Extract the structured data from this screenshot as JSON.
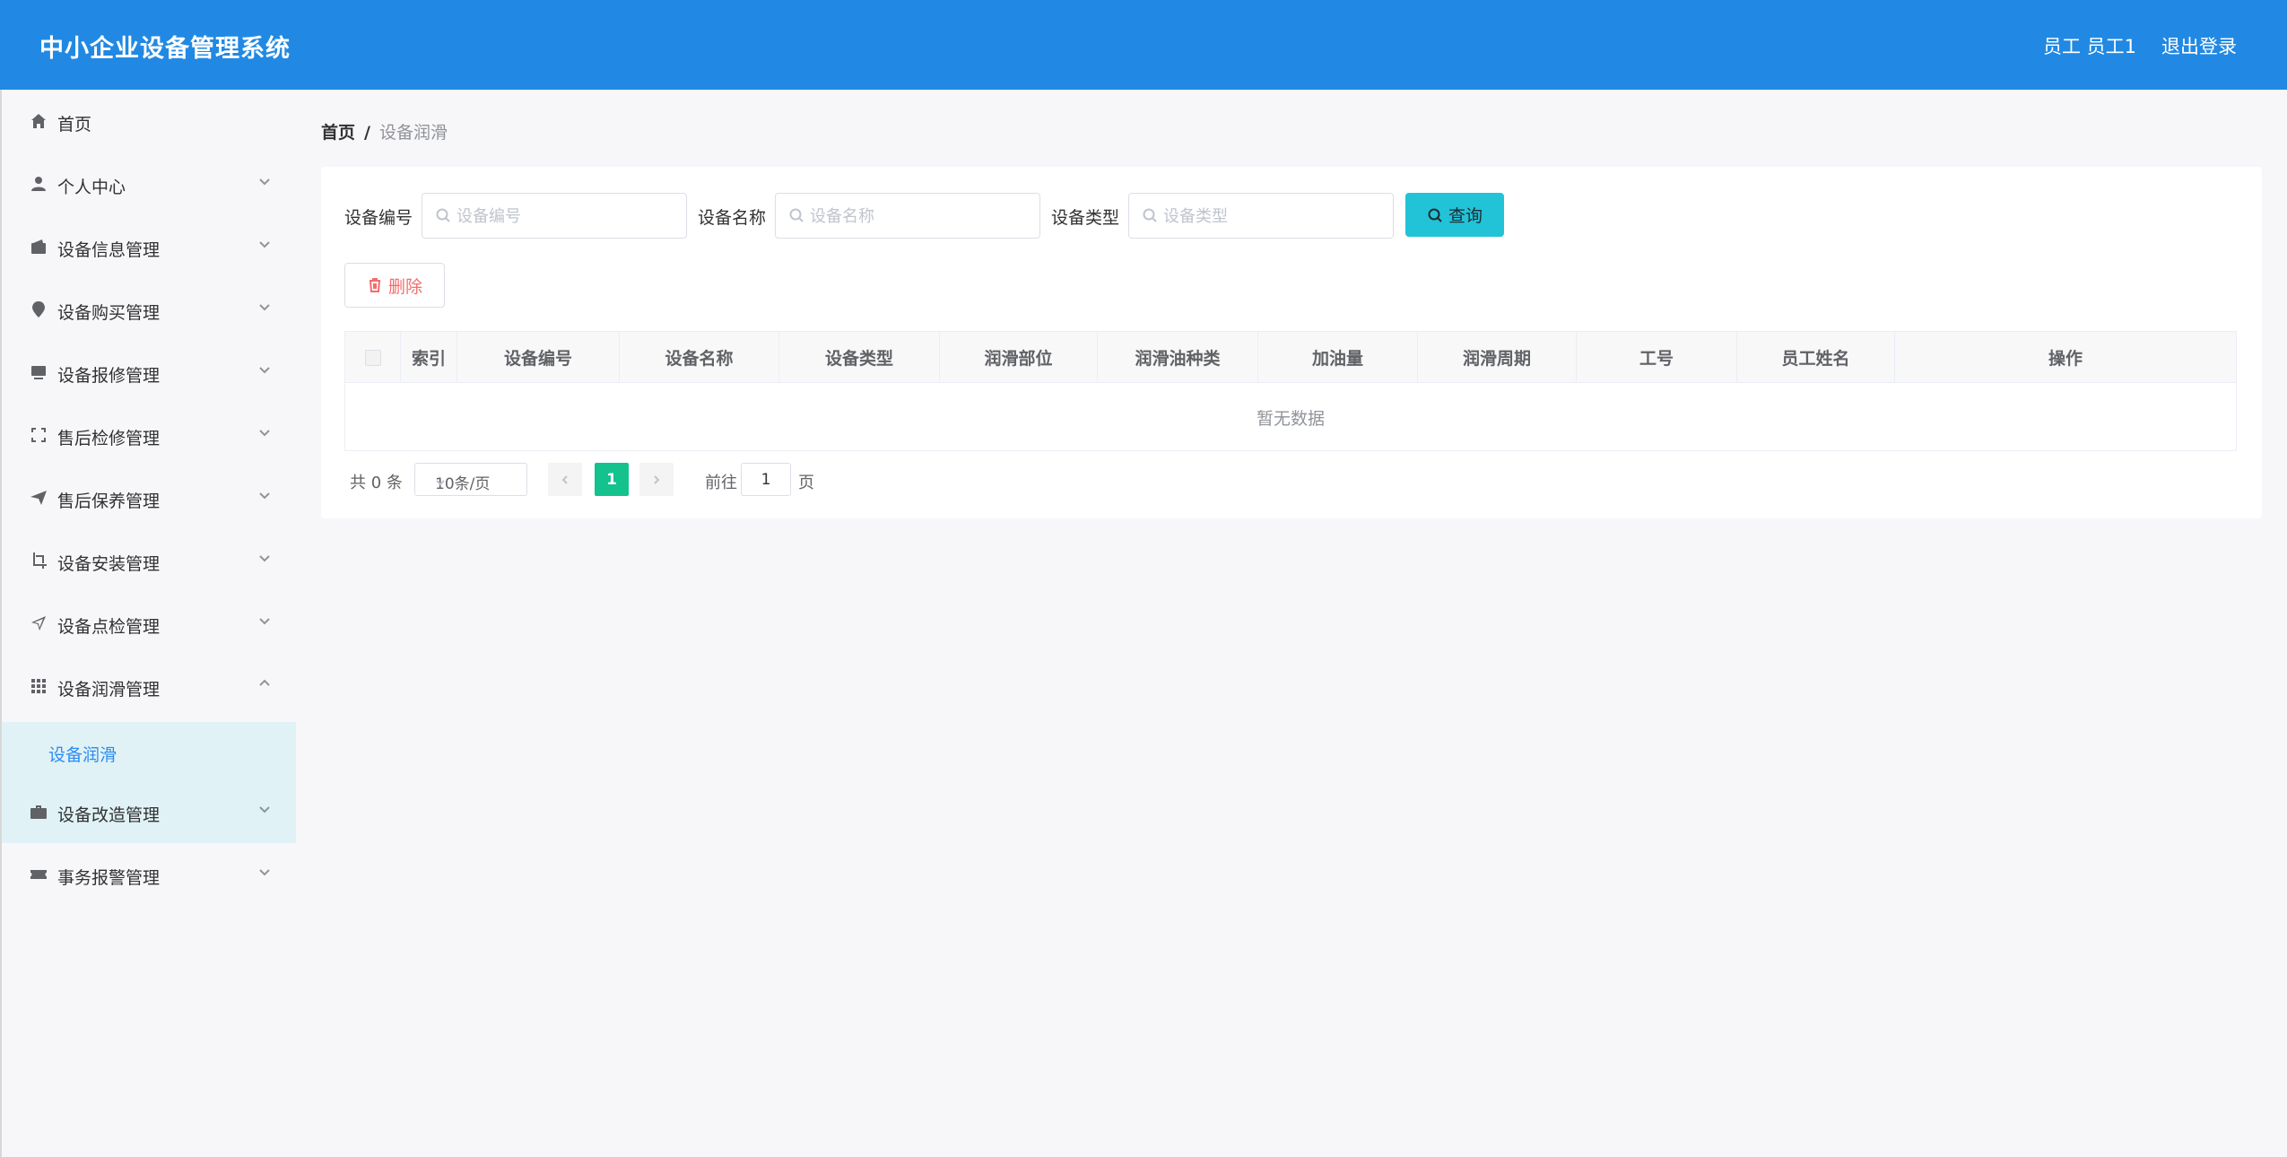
{
  "header": {
    "title": "中小企业设备管理系统",
    "user": "员工 员工1",
    "logout": "退出登录",
    "color": "#2189e3"
  },
  "sidebar": {
    "items": [
      {
        "label": "首页",
        "icon": "home-icon",
        "expandable": false
      },
      {
        "label": "个人中心",
        "icon": "user-icon",
        "expandable": true,
        "expanded": false
      },
      {
        "label": "设备信息管理",
        "icon": "wallet-icon",
        "expandable": true,
        "expanded": false
      },
      {
        "label": "设备购买管理",
        "icon": "location-pin-icon",
        "expandable": true,
        "expanded": false
      },
      {
        "label": "设备报修管理",
        "icon": "monitor-icon",
        "expandable": true,
        "expanded": false
      },
      {
        "label": "售后检修管理",
        "icon": "full-screen-icon",
        "expandable": true,
        "expanded": false
      },
      {
        "label": "售后保养管理",
        "icon": "send-icon",
        "expandable": true,
        "expanded": false
      },
      {
        "label": "设备安装管理",
        "icon": "crop-icon",
        "expandable": true,
        "expanded": false
      },
      {
        "label": "设备点检管理",
        "icon": "navigation-icon",
        "expandable": true,
        "expanded": false
      },
      {
        "label": "设备润滑管理",
        "icon": "grid-icon",
        "expandable": true,
        "expanded": true
      },
      {
        "label": "设备改造管理",
        "icon": "briefcase-icon",
        "expandable": true,
        "expanded": false
      },
      {
        "label": "事务报警管理",
        "icon": "ticket-icon",
        "expandable": true,
        "expanded": false
      }
    ],
    "active_sub": "设备润滑"
  },
  "breadcrumb": {
    "home": "首页",
    "separator": "/",
    "current": "设备润滑"
  },
  "filters": {
    "device_code": {
      "label": "设备编号",
      "placeholder": "设备编号",
      "value": ""
    },
    "device_name": {
      "label": "设备名称",
      "placeholder": "设备名称",
      "value": ""
    },
    "device_type": {
      "label": "设备类型",
      "placeholder": "设备类型",
      "value": ""
    },
    "query_label": "查询"
  },
  "actions": {
    "delete_label": "删除"
  },
  "table": {
    "columns": [
      "索引",
      "设备编号",
      "设备名称",
      "设备类型",
      "润滑部位",
      "润滑油种类",
      "加油量",
      "润滑周期",
      "工号",
      "员工姓名",
      "操作"
    ],
    "rows": [],
    "empty_text": "暂无数据"
  },
  "pagination": {
    "total_text": "共 0 条",
    "page_size": "10条/页",
    "current_page": "1",
    "goto_label": "前往",
    "goto_value": "1",
    "page_suffix": "页"
  }
}
